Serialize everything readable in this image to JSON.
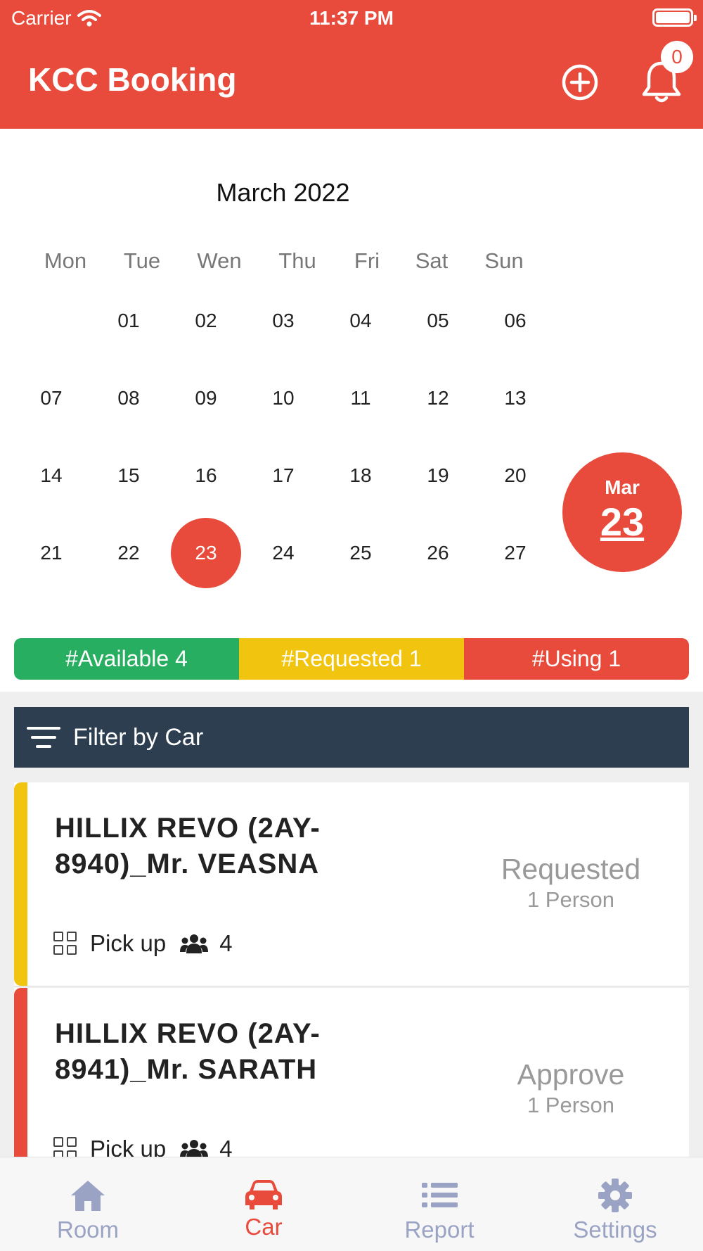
{
  "status_bar": {
    "carrier": "Carrier",
    "time": "11:37 PM"
  },
  "header": {
    "title": "KCC Booking",
    "notification_count": "0",
    "add_icon": "plus-circle-icon",
    "bell_icon": "bell-icon"
  },
  "calendar": {
    "month_title": "March 2022",
    "weekdays": [
      "Mon",
      "Tue",
      "Wen",
      "Thu",
      "Fri",
      "Sat",
      "Sun"
    ],
    "weeks": [
      [
        "",
        "01",
        "02",
        "03",
        "04",
        "05",
        "06"
      ],
      [
        "07",
        "08",
        "09",
        "10",
        "11",
        "12",
        "13"
      ],
      [
        "14",
        "15",
        "16",
        "17",
        "18",
        "19",
        "20"
      ],
      [
        "21",
        "22",
        "23",
        "24",
        "25",
        "26",
        "27"
      ]
    ],
    "selected_day": "23",
    "today_badge": {
      "month": "Mar",
      "day": "23"
    }
  },
  "status_summary": [
    {
      "label": "#Available 4",
      "color": "#27ae60"
    },
    {
      "label": "#Requested 1",
      "color": "#f1c40f"
    },
    {
      "label": "#Using 1",
      "color": "#e84b3c"
    }
  ],
  "filter": {
    "label": "Filter by Car",
    "icon": "filter-icon"
  },
  "bookings": [
    {
      "title": "HILLIX REVO (2AY-8940)_Mr. VEASNA",
      "type": "Pick up",
      "seats": "4",
      "status": "Requested",
      "persons": "1 Person",
      "stripe_color": "#f1c40f"
    },
    {
      "title": "HILLIX REVO (2AY-8941)_Mr. SARATH",
      "type": "Pick up",
      "seats": "4",
      "status": "Approve",
      "persons": "1 Person",
      "stripe_color": "#e84b3c"
    }
  ],
  "tabs": [
    {
      "label": "Room",
      "icon": "home-icon",
      "active": false
    },
    {
      "label": "Car",
      "icon": "car-icon",
      "active": true
    },
    {
      "label": "Report",
      "icon": "list-icon",
      "active": false
    },
    {
      "label": "Settings",
      "icon": "gear-icon",
      "active": false
    }
  ]
}
